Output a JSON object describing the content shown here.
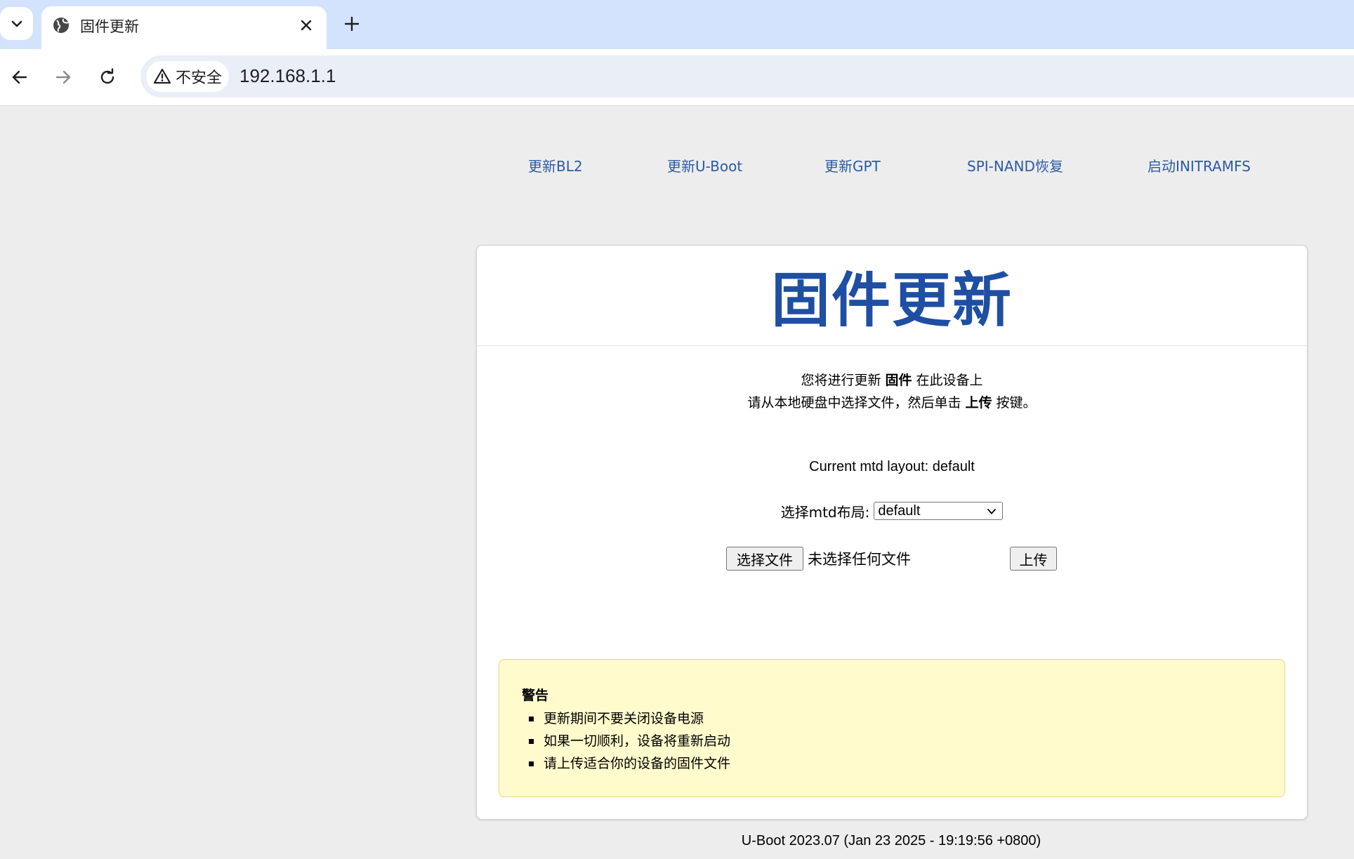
{
  "browser": {
    "tab_title": "固件更新",
    "security_label": "不安全",
    "url": "192.168.1.1"
  },
  "nav": {
    "links": [
      {
        "label": "更新BL2"
      },
      {
        "label": "更新U-Boot"
      },
      {
        "label": "更新GPT"
      },
      {
        "label": "SPI-NAND恢复"
      },
      {
        "label": "启动INITRAMFS"
      }
    ]
  },
  "main": {
    "title": "固件更新",
    "intro_line1_pre": "您将进行更新 ",
    "intro_line1_bold": "固件",
    "intro_line1_post": " 在此设备上",
    "intro_line2_pre": "请从本地硬盘中选择文件，然后单击 ",
    "intro_line2_bold": "上传",
    "intro_line2_post": " 按键。",
    "mtd_status": "Current mtd layout: default",
    "mtd_select_label": "选择mtd布局:",
    "mtd_select_value": "default",
    "choose_file_label": "选择文件",
    "no_file_text": "未选择任何文件",
    "upload_label": "上传"
  },
  "warning": {
    "title": "警告",
    "items": [
      "更新期间不要关闭设备电源",
      "如果一切顺利，设备将重新启动",
      "请上传适合你的设备的固件文件"
    ]
  },
  "footer": {
    "text": "U-Boot 2023.07 (Jan 23 2025 - 19:19:56 +0800)"
  },
  "colors": {
    "accent": "#1e4fa3",
    "link": "#2b5aa6",
    "tabstrip": "#d3e3fd",
    "warning_bg": "#fffbcc"
  }
}
